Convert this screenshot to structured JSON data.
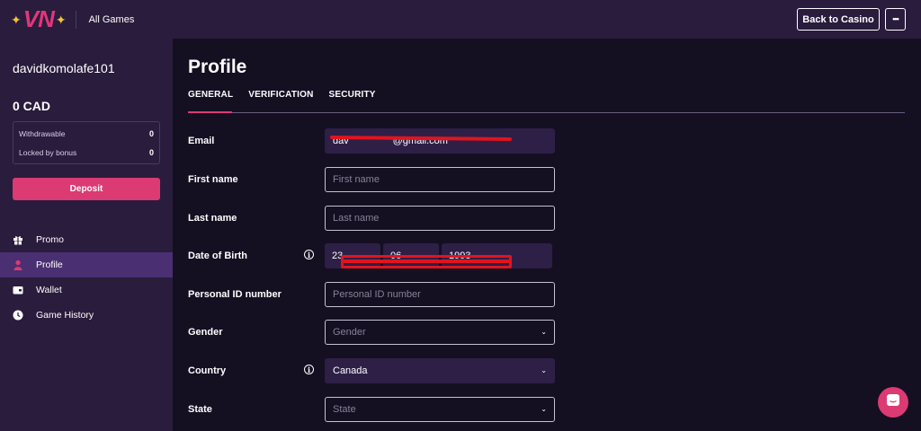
{
  "header": {
    "logo_text": "VN",
    "all_games": "All Games",
    "back_to_casino": "Back to Casino",
    "more": "•••"
  },
  "sidebar": {
    "username": "davidkomolafe101",
    "balance": "0 CAD",
    "withdrawable_label": "Withdrawable",
    "withdrawable_value": "0",
    "locked_label": "Locked by bonus",
    "locked_value": "0",
    "deposit": "Deposit",
    "items": [
      {
        "label": "Promo",
        "icon": "gift-icon"
      },
      {
        "label": "Profile",
        "icon": "user-icon",
        "active": true
      },
      {
        "label": "Wallet",
        "icon": "wallet-icon"
      },
      {
        "label": "Game History",
        "icon": "clock-icon"
      }
    ]
  },
  "main": {
    "title": "Profile",
    "tabs": [
      "GENERAL",
      "VERIFICATION",
      "SECURITY"
    ],
    "active_tab": "GENERAL",
    "form": {
      "email_label": "Email",
      "email_value": "dav                @gmail.com",
      "first_name_label": "First name",
      "first_name_placeholder": "First name",
      "last_name_label": "Last name",
      "last_name_placeholder": "Last name",
      "dob_label": "Date of Birth",
      "dob_day": "23",
      "dob_month": "06",
      "dob_year": "1993",
      "personal_id_label": "Personal ID number",
      "personal_id_placeholder": "Personal ID number",
      "gender_label": "Gender",
      "gender_placeholder": "Gender",
      "country_label": "Country",
      "country_value": "Canada",
      "state_label": "State",
      "state_placeholder": "State"
    }
  },
  "colors": {
    "accent": "#dc3a72",
    "sidebar_bg": "#2a1c3d",
    "page_bg": "#150f22",
    "active_nav": "#4a2f72",
    "redaction": "#e0141e"
  }
}
